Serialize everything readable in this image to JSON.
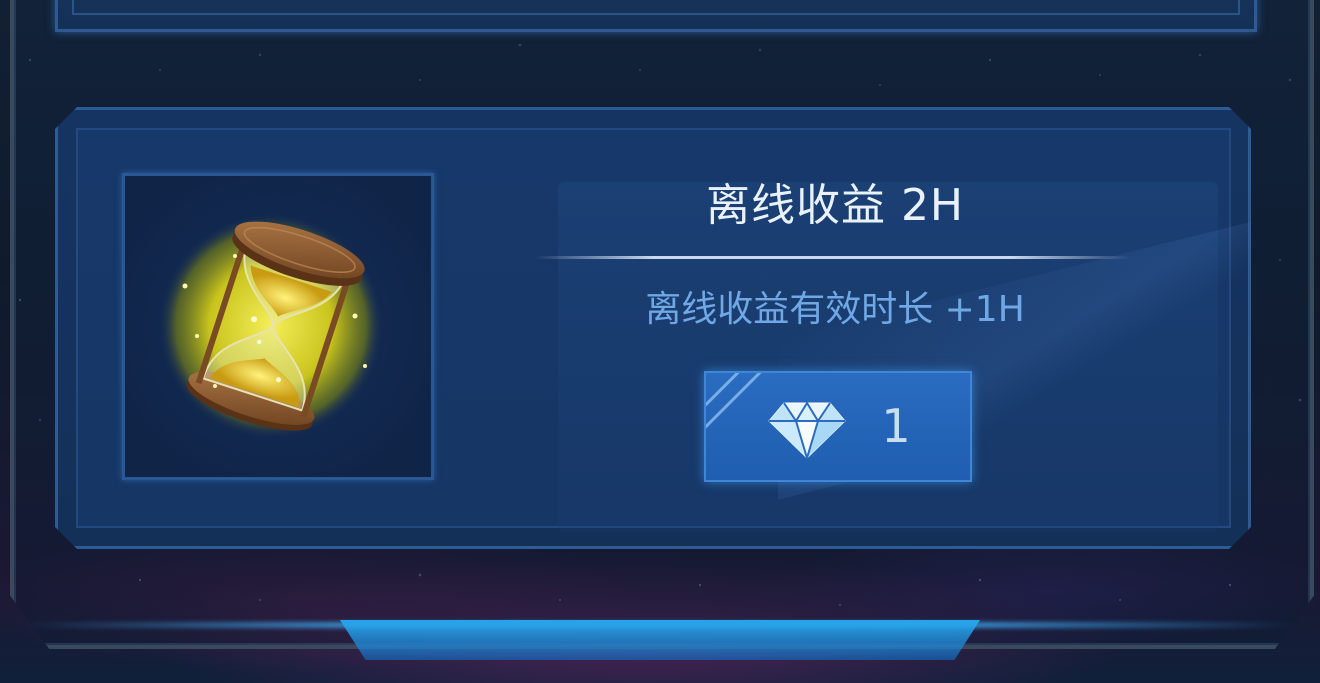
{
  "item": {
    "title": "离线收益 2H",
    "description": "离线收益有效时长  +1H",
    "icon": "hourglass-icon"
  },
  "purchase": {
    "currency_icon": "diamond-icon",
    "price": "1"
  },
  "colors": {
    "title_text": "#e9f1fb",
    "description_text": "#6fa8e4",
    "card_background": "#163461",
    "card_border": "#2c5b96",
    "button_background": "#2a6cc0",
    "hourglass_glow": "#d8d21a"
  }
}
